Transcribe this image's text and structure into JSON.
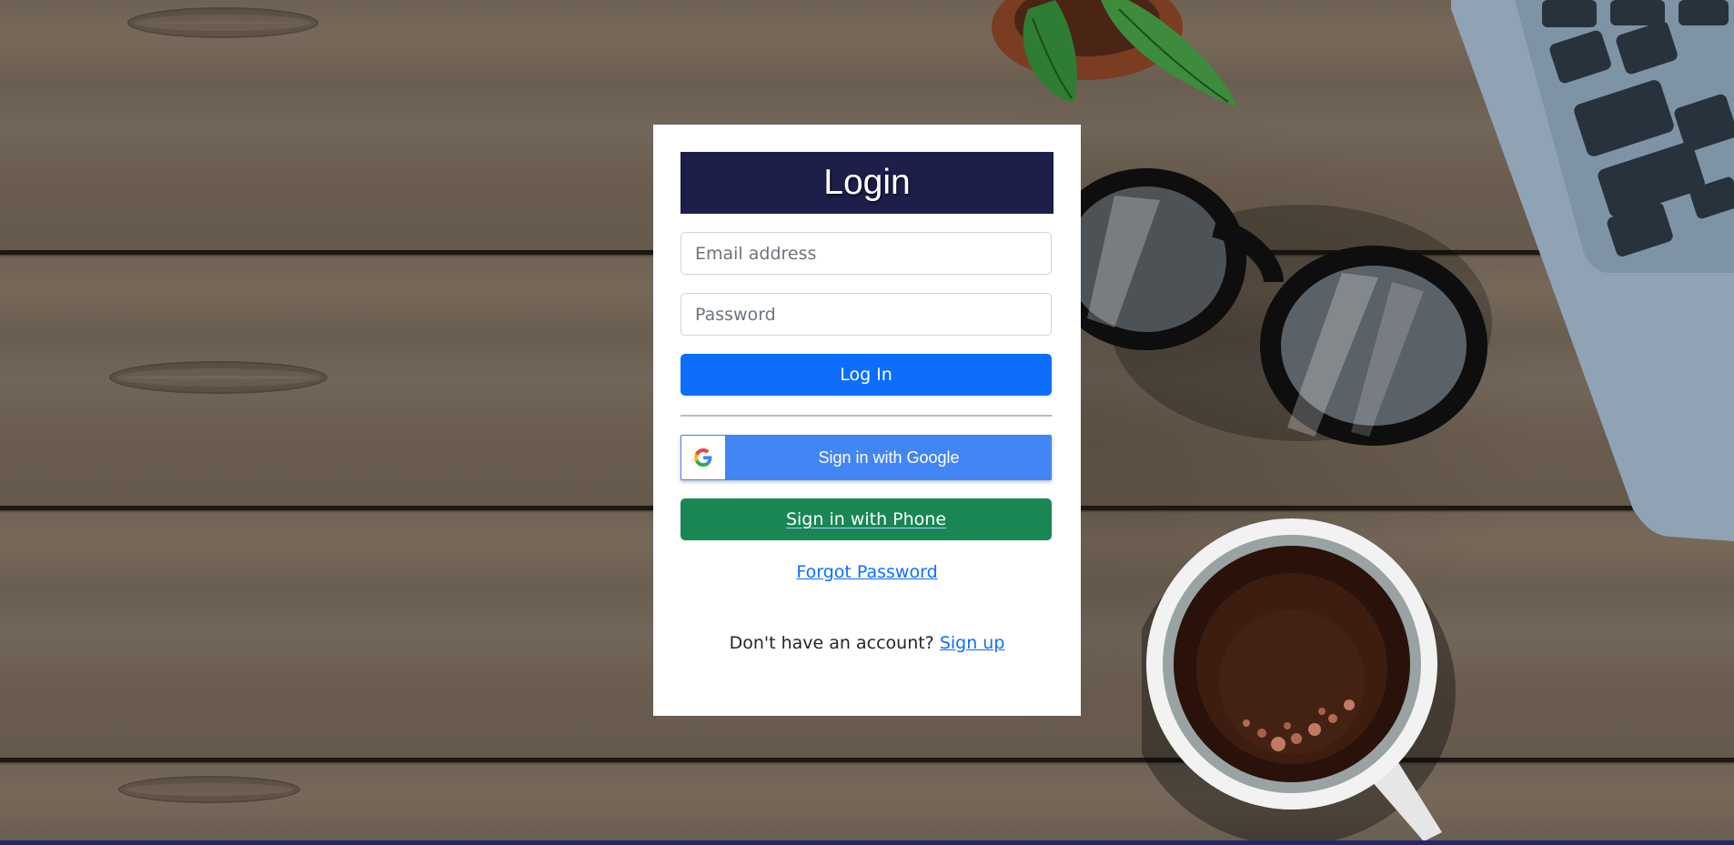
{
  "form": {
    "title": "Login",
    "email_placeholder": "Email address",
    "password_placeholder": "Password",
    "login_label": "Log In",
    "google_label": "Sign in with Google",
    "phone_label": "Sign in with Phone",
    "forgot_label": "Forgot Password",
    "signup_prompt": "Don't have an account?",
    "signup_link": "Sign up"
  },
  "colors": {
    "title_bg": "#1e1e4b",
    "login_button": "#0d6efd",
    "google_button": "#4285f4",
    "phone_button": "#198754",
    "link": "#0d6efd"
  },
  "icons": {
    "google": "google-g-icon"
  }
}
